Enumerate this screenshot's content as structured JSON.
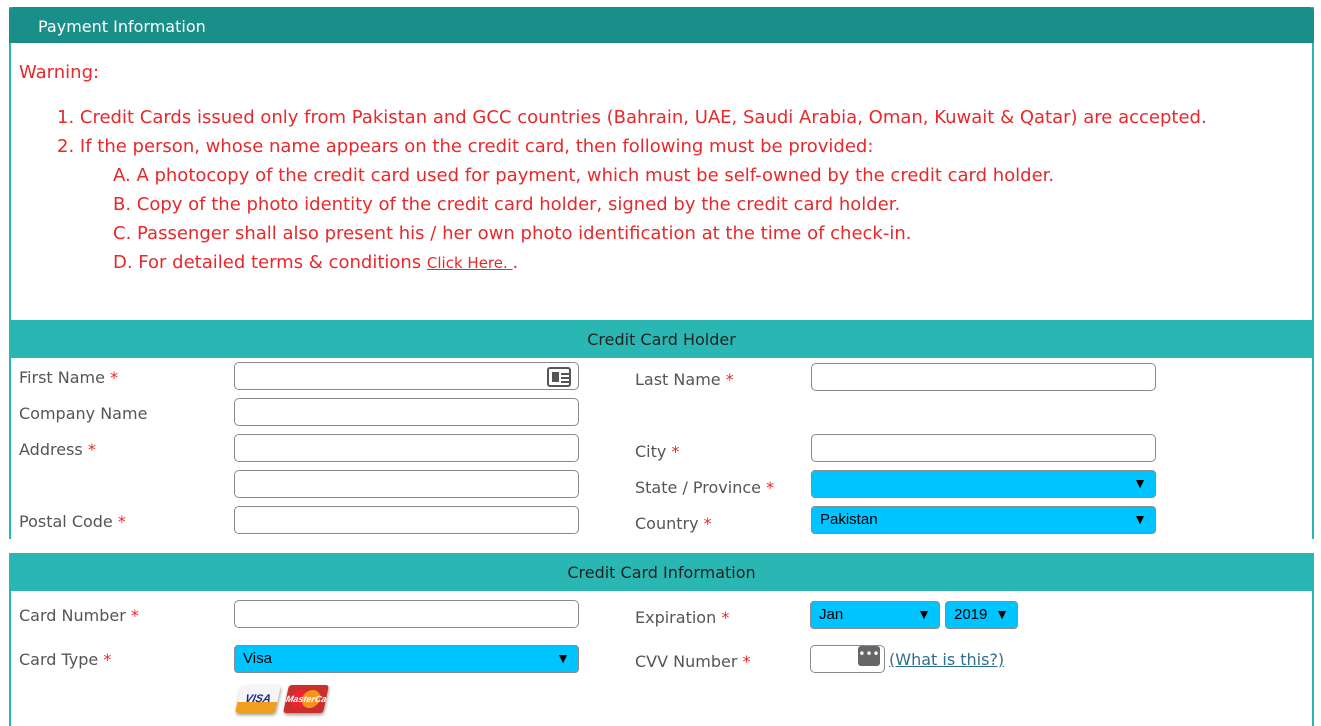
{
  "header": {
    "title": "Payment Information"
  },
  "warning": {
    "title": "Warning:",
    "items": [
      "1. Credit Cards issued only from Pakistan and GCC countries (Bahrain, UAE, Saudi Arabia, Oman, Kuwait & Qatar) are accepted.",
      "2. If the person, whose name appears on the credit card, then following must be provided:"
    ],
    "subitems": [
      "A. A photocopy of the credit card used for payment, which must be self-owned by the credit card holder.",
      "B. Copy of the photo identity of the credit card holder, signed by the credit card holder.",
      "C. Passenger shall also present his / her own photo identification at the time of check-in.",
      "D. For detailed terms & conditions "
    ],
    "link_text": "Click Here. ",
    "link_suffix": "."
  },
  "holder": {
    "title": "Credit Card Holder",
    "first_name": "First Name",
    "last_name": "Last Name",
    "company_name": "Company Name",
    "address": "Address",
    "city": "City",
    "state": "State / Province",
    "postal_code": "Postal Code",
    "country": "Country",
    "state_value": "",
    "country_value": "Pakistan"
  },
  "card": {
    "title": "Credit Card Information",
    "card_number": "Card Number",
    "card_type": "Card Type",
    "card_type_value": "Visa",
    "expiration": "Expiration",
    "exp_month": "Jan",
    "exp_year": "2019",
    "cvv": "CVV Number",
    "cvv_link": "(What is this?)",
    "visa_text": "VISA",
    "mc_text": "MasterCard"
  },
  "required_mark": "*",
  "arrow_glyph": "▼",
  "cvv_glyph": "•••",
  "colors": {
    "header_bg": "#1a8f8a",
    "section_bg": "#2ab7b3",
    "warning_text": "#e8282b",
    "select_bg": "#00c4ff"
  }
}
